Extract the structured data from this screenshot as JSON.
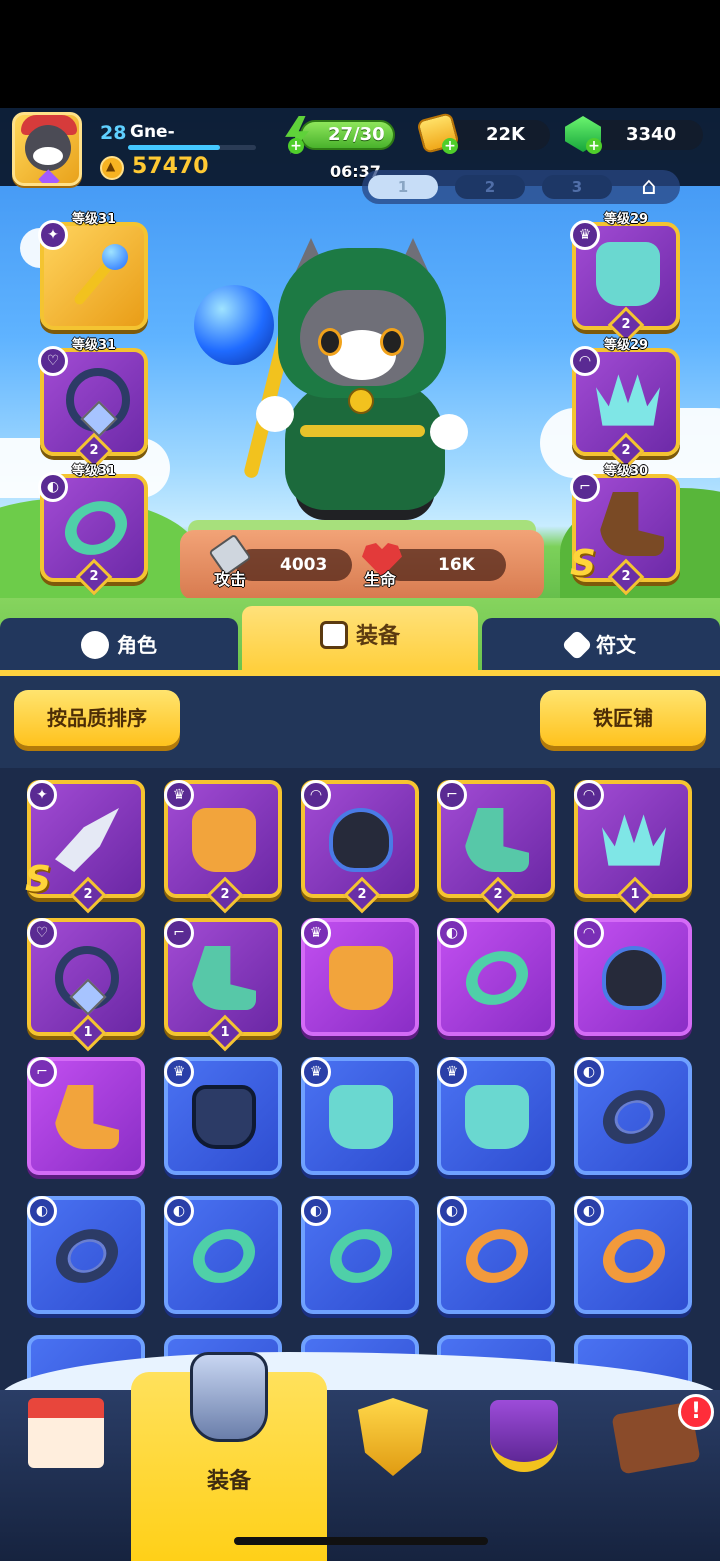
{
  "player": {
    "level": "28",
    "name": "Gne-",
    "power": "57470"
  },
  "resources": {
    "energy": "27/30",
    "coins": "22K",
    "gems": "3340",
    "timer": "06:37"
  },
  "presets": [
    "1",
    "2",
    "3"
  ],
  "equipped": {
    "left": [
      {
        "level_label": "等级31",
        "type": "weapon",
        "stars": ""
      },
      {
        "level_label": "等级31",
        "type": "amulet",
        "stars": "2"
      },
      {
        "level_label": "等级31",
        "type": "ring",
        "stars": "2"
      }
    ],
    "right": [
      {
        "level_label": "等级29",
        "type": "armor",
        "stars": "2"
      },
      {
        "level_label": "等级29",
        "type": "helmet",
        "stars": "2"
      },
      {
        "level_label": "等级30",
        "type": "boots",
        "stars": "2",
        "grade": "S"
      }
    ]
  },
  "stats": {
    "attack_label": "攻击",
    "attack_value": "4003",
    "hp_label": "生命",
    "hp_value": "16K"
  },
  "tabs": {
    "character": "角色",
    "equipment": "装备",
    "runes": "符文"
  },
  "buttons": {
    "sort": "按品质排序",
    "blacksmith": "铁匠铺"
  },
  "inventory": {
    "row1": [
      {
        "rarity": "gold",
        "item": "weapon-wing",
        "stars": "2",
        "grade": "S"
      },
      {
        "rarity": "gold",
        "item": "armor-orange",
        "stars": "2"
      },
      {
        "rarity": "gold",
        "item": "mask",
        "stars": "2"
      },
      {
        "rarity": "gold",
        "item": "boots-teal",
        "stars": "2"
      },
      {
        "rarity": "gold",
        "item": "crown",
        "stars": "1"
      }
    ],
    "row2": [
      {
        "rarity": "gold",
        "item": "amulet",
        "stars": "1"
      },
      {
        "rarity": "gold",
        "item": "boots-teal",
        "stars": "1"
      },
      {
        "rarity": "purple",
        "item": "armor-orange"
      },
      {
        "rarity": "purple",
        "item": "ring-teal"
      },
      {
        "rarity": "purple",
        "item": "mask"
      }
    ],
    "row3": [
      {
        "rarity": "purple",
        "item": "boots-orange"
      },
      {
        "rarity": "blue",
        "item": "cape"
      },
      {
        "rarity": "blue",
        "item": "armor-teal"
      },
      {
        "rarity": "blue",
        "item": "armor-teal"
      },
      {
        "rarity": "blue",
        "item": "ring-dark"
      }
    ],
    "row4": [
      {
        "rarity": "blue",
        "item": "ring-dark"
      },
      {
        "rarity": "blue",
        "item": "ring-teal"
      },
      {
        "rarity": "blue",
        "item": "ring-teal"
      },
      {
        "rarity": "blue",
        "item": "ring-orange"
      },
      {
        "rarity": "blue",
        "item": "ring-orange"
      }
    ]
  },
  "bottom_nav": {
    "active_label": "装备",
    "notification": "!"
  },
  "colors": {
    "gold_border": "#f6c430",
    "purple_card": "#a24bd4",
    "blue_card": "#4a72f2",
    "accent_yellow": "#ffd23f",
    "panel": "#1c2b4a"
  }
}
